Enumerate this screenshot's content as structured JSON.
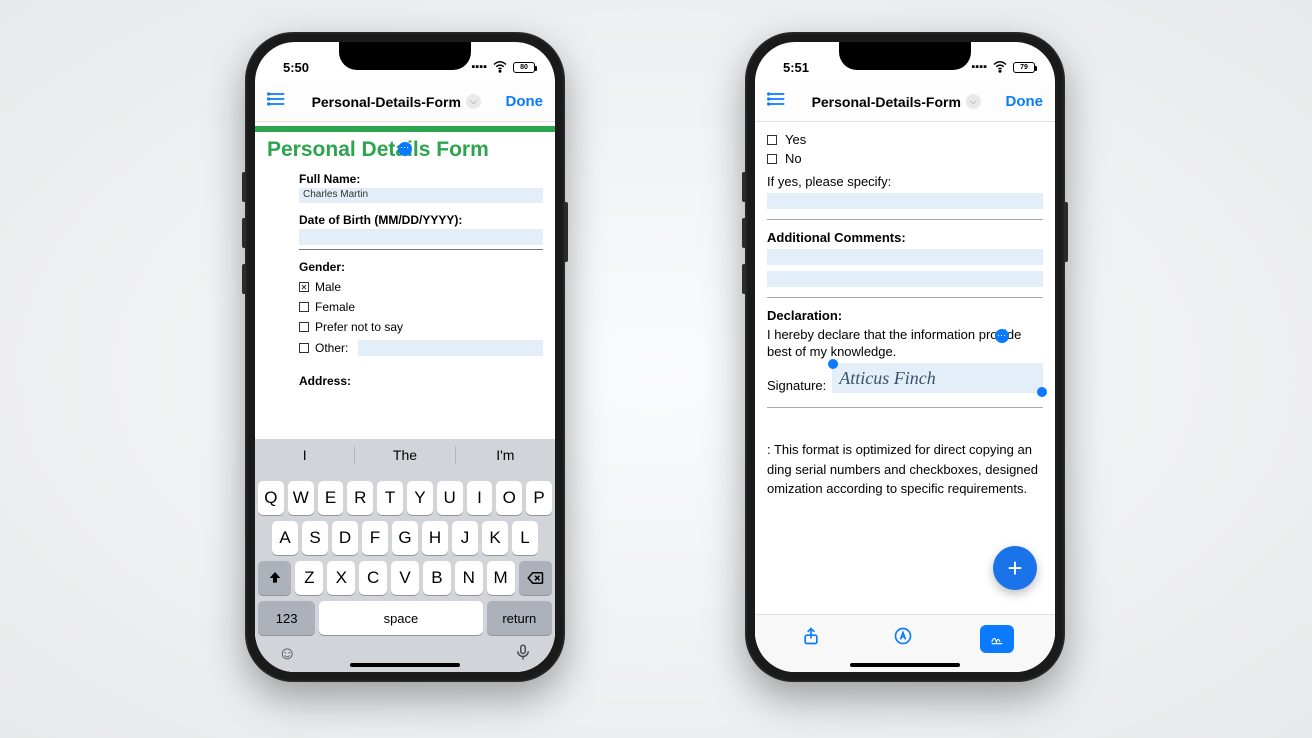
{
  "left": {
    "status": {
      "time": "5:50",
      "battery": "80"
    },
    "nav": {
      "title": "Personal-Details-Form",
      "done": "Done"
    },
    "form": {
      "title": "Personal Details Form",
      "full_name_label": "Full Name:",
      "full_name_value": "Charles Martin",
      "dob_label": "Date of Birth (MM/DD/YYYY):",
      "gender_label": "Gender:",
      "gender_options": {
        "male": "Male",
        "female": "Female",
        "prefer": "Prefer not to say",
        "other": "Other:"
      },
      "gender_checked": "male",
      "address_label": "Address:"
    },
    "keyboard": {
      "suggestions": [
        "I",
        "The",
        "I'm"
      ],
      "row1": [
        "Q",
        "W",
        "E",
        "R",
        "T",
        "Y",
        "U",
        "I",
        "O",
        "P"
      ],
      "row2": [
        "A",
        "S",
        "D",
        "F",
        "G",
        "H",
        "J",
        "K",
        "L"
      ],
      "row3": [
        "Z",
        "X",
        "C",
        "V",
        "B",
        "N",
        "M"
      ],
      "numbers_key": "123",
      "space_key": "space",
      "return_key": "return"
    }
  },
  "right": {
    "status": {
      "time": "5:51",
      "battery": "79"
    },
    "nav": {
      "title": "Personal-Details-Form",
      "done": "Done"
    },
    "doc": {
      "yes": "Yes",
      "no": "No",
      "specify": "If yes, please specify:",
      "additional_label": "Additional Comments:",
      "declaration_label": "Declaration:",
      "declaration_body_1": "I hereby declare that the information provide",
      "declaration_body_2": "best of my knowledge.",
      "signature_label": "Signature:",
      "signature_value": "Atticus Finch",
      "note_1": ": This format is optimized for direct copying an",
      "note_2": "ding serial numbers and checkboxes, designed",
      "note_3": "omization according to specific requirements."
    },
    "fab": "+"
  }
}
